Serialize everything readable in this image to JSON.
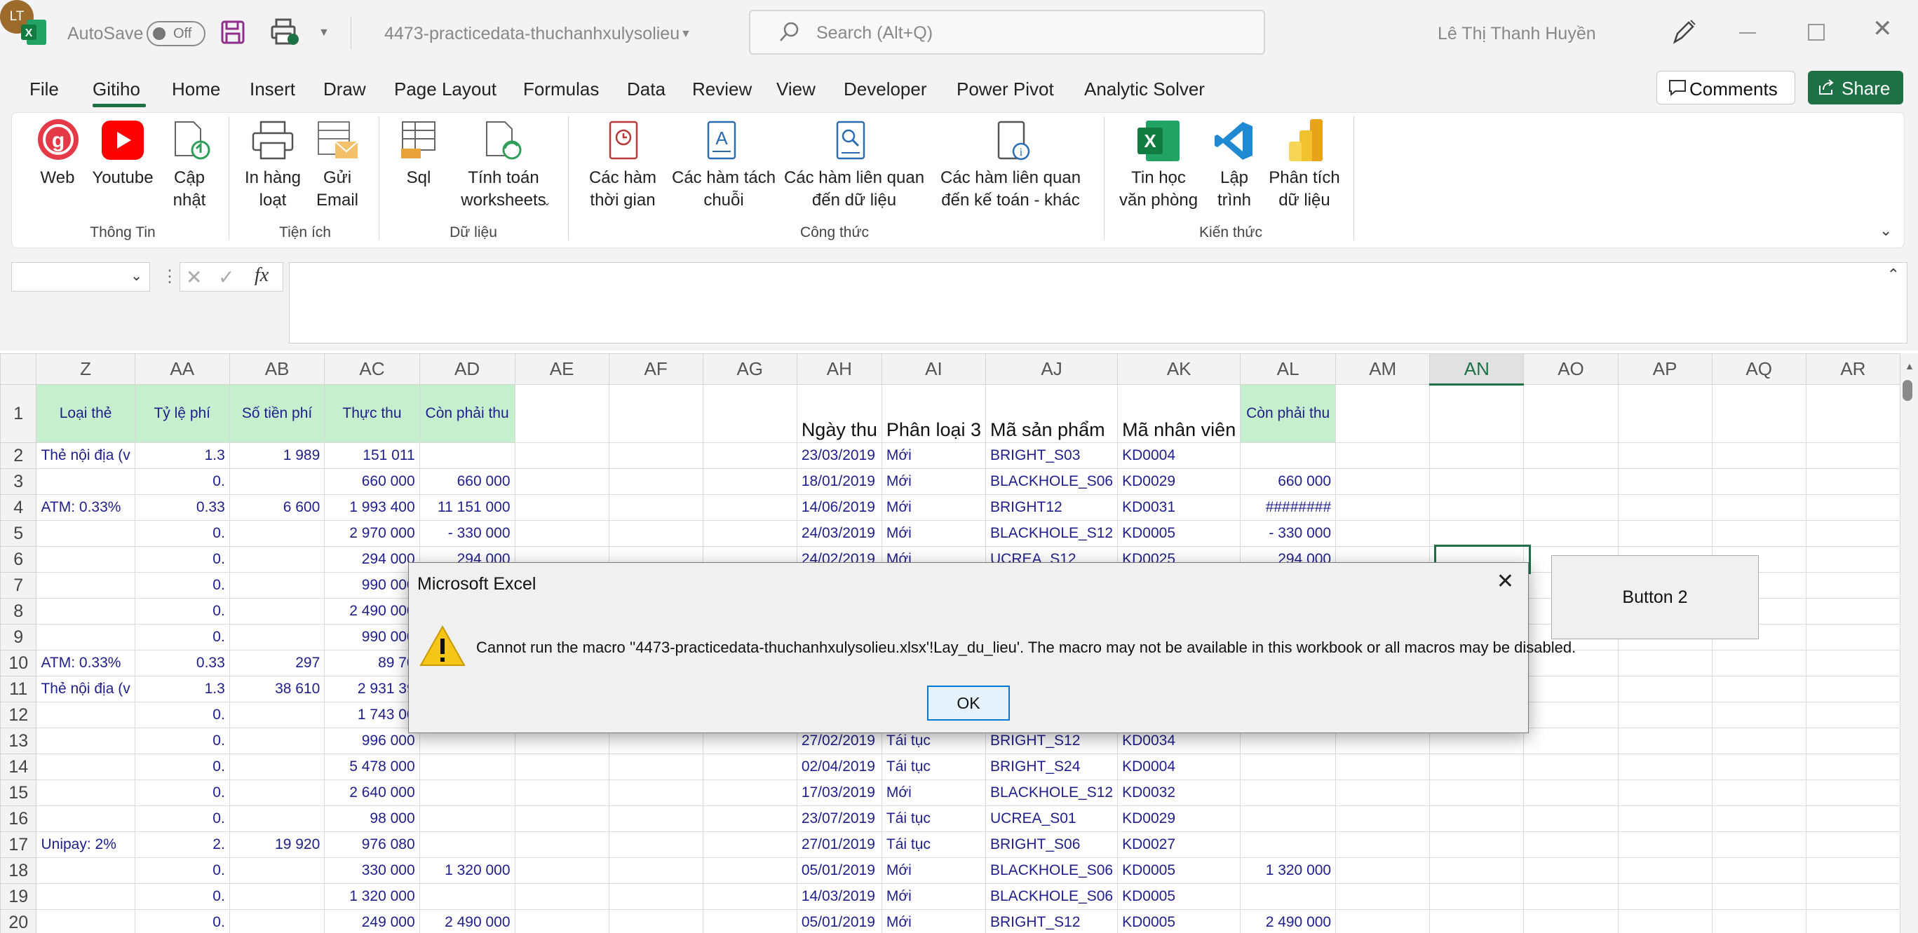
{
  "titlebar": {
    "autosave_label": "AutoSave",
    "autosave_state": "Off",
    "filename": "4473-practicedata-thuchanhxulysolieu",
    "search_placeholder": "Search (Alt+Q)",
    "user_name": "Lê Thị Thanh Huyền",
    "user_initials": "LT"
  },
  "menu": {
    "tabs": [
      "File",
      "Gitiho",
      "Home",
      "Insert",
      "Draw",
      "Page Layout",
      "Formulas",
      "Data",
      "Review",
      "View",
      "Developer",
      "Power Pivot",
      "Analytic Solver"
    ],
    "active_tab": "Gitiho",
    "comments_label": "Comments",
    "share_label": "Share"
  },
  "ribbon": {
    "buttons": [
      {
        "label": "Web",
        "icon": "gitiho-logo-icon"
      },
      {
        "label": "Youtube",
        "icon": "youtube-icon"
      },
      {
        "label": "Cập\nnhật",
        "icon": "update-file-icon"
      },
      {
        "label": "In hàng\nloạt",
        "icon": "printer-icon"
      },
      {
        "label": "Gửi\nEmail",
        "icon": "email-icon"
      },
      {
        "label": "Sql",
        "icon": "sql-icon"
      },
      {
        "label": "Tính toán\nworksheets",
        "icon": "recalculate-icon"
      },
      {
        "label": "Các hàm\nthời gian",
        "icon": "time-functions-icon"
      },
      {
        "label": "Các hàm tách\nchuỗi",
        "icon": "string-functions-icon"
      },
      {
        "label": "Các hàm liên quan\nđến dữ liệu",
        "icon": "data-functions-icon"
      },
      {
        "label": "Các hàm liên quan\nđến kế toán - khác",
        "icon": "accounting-functions-icon"
      },
      {
        "label": "Tin học\nvăn phòng",
        "icon": "excel-icon"
      },
      {
        "label": "Lập\ntrình",
        "icon": "vscode-icon"
      },
      {
        "label": "Phân tích\ndữ liệu",
        "icon": "powerbi-icon"
      }
    ],
    "groups": [
      "Thông Tin",
      "Tiện ích",
      "Dữ liệu",
      "Công thức",
      "Kiến thức"
    ]
  },
  "formula_bar": {
    "name_box": "",
    "formula": "",
    "fx_label": "fx"
  },
  "sheet": {
    "columns": [
      "Z",
      "AA",
      "AB",
      "AC",
      "AD",
      "AE",
      "AF",
      "AG",
      "AH",
      "AI",
      "AJ",
      "AK",
      "AL",
      "AM",
      "AN",
      "AO",
      "AP",
      "AQ",
      "AR"
    ],
    "selected_column": "AN",
    "header_row": {
      "Z": "Loại thẻ",
      "AA": "Tỷ lệ phí",
      "AB": "Số tiền phí",
      "AC": "Thực thu",
      "AD": "Còn phải thu",
      "AH": "Ngày thu",
      "AI": "Phân loại 3",
      "AJ": "Mã sản phẩm",
      "AK": "Mã nhân viên",
      "AL": "Còn phải thu"
    },
    "rows": [
      {
        "n": "2",
        "Z": "Thẻ nội địa (v",
        "AA": "1.3",
        "AB": "1 989",
        "AC": "151 011",
        "AD": "",
        "AH": "23/03/2019",
        "AI": "Mới",
        "AJ": "BRIGHT_S03",
        "AK": "KD0004",
        "AL": ""
      },
      {
        "n": "3",
        "Z": "",
        "AA": "0.",
        "AB": "",
        "AC": "660 000",
        "AD": "660 000",
        "AH": "18/01/2019",
        "AI": "Mới",
        "AJ": "BLACKHOLE_S06",
        "AK": "KD0029",
        "AL": "660 000"
      },
      {
        "n": "4",
        "Z": "ATM: 0.33%",
        "AA": "0.33",
        "AB": "6 600",
        "AC": "1 993 400",
        "AD": "11 151 000",
        "AH": "14/06/2019",
        "AI": "Mới",
        "AJ": "BRIGHT12",
        "AK": "KD0031",
        "AL": "########"
      },
      {
        "n": "5",
        "Z": "",
        "AA": "0.",
        "AB": "",
        "AC": "2 970 000",
        "AD": "-     330 000",
        "AH": "24/03/2019",
        "AI": "Mới",
        "AJ": "BLACKHOLE_S12",
        "AK": "KD0005",
        "AL": "-     330 000"
      },
      {
        "n": "6",
        "Z": "",
        "AA": "0.",
        "AB": "",
        "AC": "294 000",
        "AD": "294 000",
        "AH": "24/02/2019",
        "AI": "Mới",
        "AJ": "UCREA_S12",
        "AK": "KD0025",
        "AL": "294 000"
      },
      {
        "n": "7",
        "Z": "",
        "AA": "0.",
        "AB": "",
        "AC": "990 000",
        "AD": "",
        "AH": "",
        "AI": "",
        "AJ": "",
        "AK": "",
        "AL": ""
      },
      {
        "n": "8",
        "Z": "",
        "AA": "0.",
        "AB": "",
        "AC": "2 490 000",
        "AD": "",
        "AH": "",
        "AI": "",
        "AJ": "",
        "AK": "",
        "AL": ""
      },
      {
        "n": "9",
        "Z": "",
        "AA": "0.",
        "AB": "",
        "AC": "990 000",
        "AD": "",
        "AH": "",
        "AI": "",
        "AJ": "",
        "AK": "",
        "AL": ""
      },
      {
        "n": "10",
        "Z": "ATM: 0.33%",
        "AA": "0.33",
        "AB": "297",
        "AC": "89 70",
        "AD": "",
        "AH": "",
        "AI": "",
        "AJ": "",
        "AK": "",
        "AL": ""
      },
      {
        "n": "11",
        "Z": "Thẻ nội địa (v",
        "AA": "1.3",
        "AB": "38 610",
        "AC": "2 931 39",
        "AD": "",
        "AH": "",
        "AI": "",
        "AJ": "",
        "AK": "",
        "AL": ""
      },
      {
        "n": "12",
        "Z": "",
        "AA": "0.",
        "AB": "",
        "AC": "1 743 00",
        "AD": "",
        "AH": "",
        "AI": "",
        "AJ": "",
        "AK": "",
        "AL": ""
      },
      {
        "n": "13",
        "Z": "",
        "AA": "0.",
        "AB": "",
        "AC": "996 000",
        "AD": "",
        "AH": "27/02/2019",
        "AI": "Tái tục",
        "AJ": "BRIGHT_S12",
        "AK": "KD0034",
        "AL": ""
      },
      {
        "n": "14",
        "Z": "",
        "AA": "0.",
        "AB": "",
        "AC": "5 478 000",
        "AD": "",
        "AH": "02/04/2019",
        "AI": "Tái tục",
        "AJ": "BRIGHT_S24",
        "AK": "KD0004",
        "AL": ""
      },
      {
        "n": "15",
        "Z": "",
        "AA": "0.",
        "AB": "",
        "AC": "2 640 000",
        "AD": "",
        "AH": "17/03/2019",
        "AI": "Mới",
        "AJ": "BLACKHOLE_S12",
        "AK": "KD0032",
        "AL": ""
      },
      {
        "n": "16",
        "Z": "",
        "AA": "0.",
        "AB": "",
        "AC": "98 000",
        "AD": "",
        "AH": "23/07/2019",
        "AI": "Tái tục",
        "AJ": "UCREA_S01",
        "AK": "KD0029",
        "AL": ""
      },
      {
        "n": "17",
        "Z": "Unipay: 2%",
        "AA": "2.",
        "AB": "19 920",
        "AC": "976 080",
        "AD": "",
        "AH": "27/01/2019",
        "AI": "Tái tục",
        "AJ": "BRIGHT_S06",
        "AK": "KD0027",
        "AL": ""
      },
      {
        "n": "18",
        "Z": "",
        "AA": "0.",
        "AB": "",
        "AC": "330 000",
        "AD": "1 320 000",
        "AH": "05/01/2019",
        "AI": "Mới",
        "AJ": "BLACKHOLE_S06",
        "AK": "KD0005",
        "AL": "1 320 000"
      },
      {
        "n": "19",
        "Z": "",
        "AA": "0.",
        "AB": "",
        "AC": "1 320 000",
        "AD": "",
        "AH": "14/03/2019",
        "AI": "Mới",
        "AJ": "BLACKHOLE_S06",
        "AK": "KD0005",
        "AL": ""
      },
      {
        "n": "20",
        "Z": "",
        "AA": "0.",
        "AB": "",
        "AC": "249 000",
        "AD": "2 490 000",
        "AH": "05/01/2019",
        "AI": "Mới",
        "AJ": "BRIGHT_S12",
        "AK": "KD0005",
        "AL": "2 490 000"
      }
    ],
    "button2_label": "Button 2"
  },
  "dialog": {
    "title": "Microsoft Excel",
    "message": "Cannot run the macro ''4473-practicedata-thuchanhxulysolieu.xlsx'!Lay_du_lieu'. The macro may not be available in this workbook or all macros may be disabled.",
    "ok_label": "OK",
    "icon": "warning-icon"
  },
  "colors": {
    "accent": "#1e7145",
    "header_fill": "#c6efce",
    "cell_text": "#1f1f8c"
  }
}
